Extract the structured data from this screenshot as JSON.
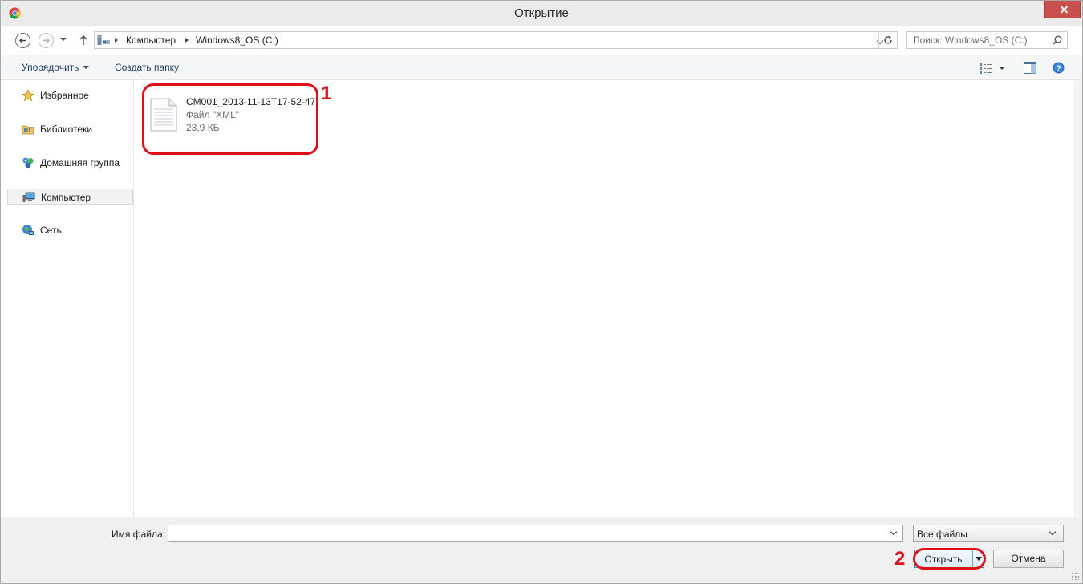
{
  "window": {
    "title": "Открытие",
    "colors": {
      "close_button": "#c7504c",
      "accent": "#3c7fb1",
      "annotation": "#e0101a"
    }
  },
  "address_bar": {
    "icon": "computer-drive-icon",
    "breadcrumbs": [
      "Компьютер",
      "Windows8_OS (C:)"
    ]
  },
  "search": {
    "placeholder": "Поиск: Windows8_OS (C:)",
    "value": ""
  },
  "toolbar": {
    "organize_label": "Упорядочить",
    "new_folder_label": "Создать папку"
  },
  "sidebar": {
    "items": [
      {
        "label": "Избранное",
        "icon": "star-icon"
      },
      {
        "label": "Библиотеки",
        "icon": "libraries-folder-icon"
      },
      {
        "label": "Домашняя группа",
        "icon": "homegroup-icon"
      },
      {
        "label": "Компьютер",
        "icon": "computer-icon"
      },
      {
        "label": "Сеть",
        "icon": "network-icon"
      }
    ],
    "selected": "Компьютер"
  },
  "files": [
    {
      "name": "CM001_2013-11-13T17-52-47",
      "type": "Файл \"XML\"",
      "size": "23,9 КБ",
      "icon": "document-file-icon"
    }
  ],
  "footer": {
    "filename_label": "Имя файла:",
    "filename_value": "",
    "filetype_value": "Все файлы",
    "open_label": "Открыть",
    "cancel_label": "Отмена"
  },
  "annotations": {
    "mark_1": "1",
    "mark_2": "2"
  }
}
